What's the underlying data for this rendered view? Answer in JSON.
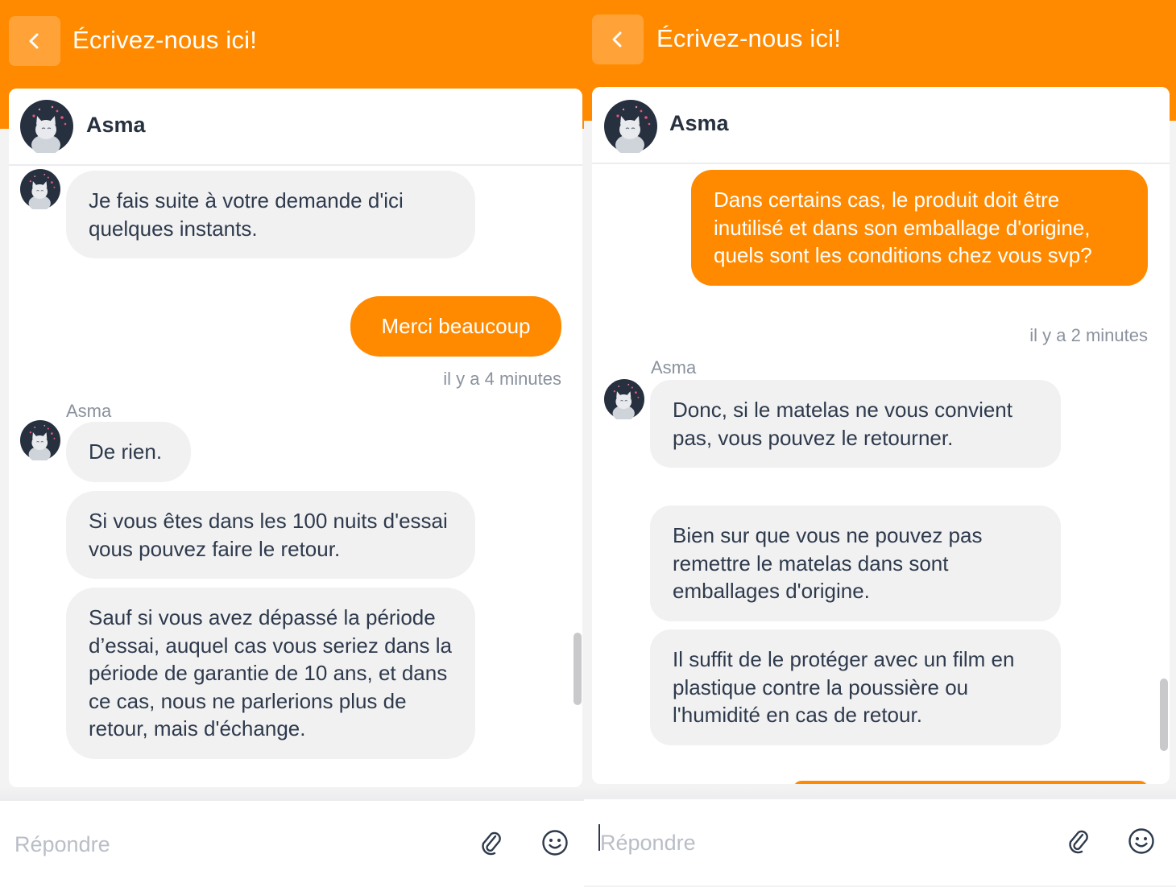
{
  "theme": {
    "accent": "#ff8a00",
    "bubble_agent": "#f1f1f2",
    "text_dark": "#2e3a4c",
    "muted": "#8a929e"
  },
  "panels": [
    {
      "header": {
        "title": "Écrivez-nous ici!",
        "back_icon": "chevron-left-icon"
      },
      "agent": {
        "name": "Asma",
        "avatar_icon": "cat-avatar-icon"
      },
      "messages": [
        {
          "from": "agent",
          "text": "Je fais suite à votre demande d'ici quelques instants."
        },
        {
          "from": "user",
          "text": "Merci beaucoup",
          "time": "il y a 4 minutes"
        },
        {
          "from": "agent",
          "sender": "Asma",
          "text": "De rien."
        },
        {
          "from": "agent",
          "text": "Si vous êtes dans les 100 nuits d'essai vous pouvez faire le retour."
        },
        {
          "from": "agent",
          "text": "Sauf si vous avez dépassé la période d’essai, auquel cas vous seriez dans la période de garantie de 10 ans, et dans ce cas, nous ne parlerions plus de retour, mais d'échange."
        }
      ],
      "composer": {
        "placeholder": "Répondre",
        "attach_icon": "paperclip-icon",
        "emoji_icon": "smiley-icon"
      }
    },
    {
      "header": {
        "title": "Écrivez-nous ici!",
        "back_icon": "chevron-left-icon"
      },
      "agent": {
        "name": "Asma",
        "avatar_icon": "cat-avatar-icon"
      },
      "messages": [
        {
          "from": "user",
          "text": "Dans certains cas, le produit doit être inutilisé et dans son emballage d'origine, quels sont les conditions chez vous svp?",
          "time": "il y a 2 minutes"
        },
        {
          "from": "agent",
          "sender": "Asma",
          "text": "Donc, si le matelas ne vous convient pas, vous pouvez le retourner."
        },
        {
          "from": "agent",
          "text": "Bien sur que vous ne pouvez pas remettre le matelas dans sont emballages d'origine."
        },
        {
          "from": "agent",
          "text": "Il suffit de le protéger avec un film en plastique contre la poussière ou l'humidité en cas de retour."
        }
      ],
      "composer": {
        "placeholder": "Répondre",
        "attach_icon": "paperclip-icon",
        "emoji_icon": "smiley-icon"
      }
    }
  ]
}
